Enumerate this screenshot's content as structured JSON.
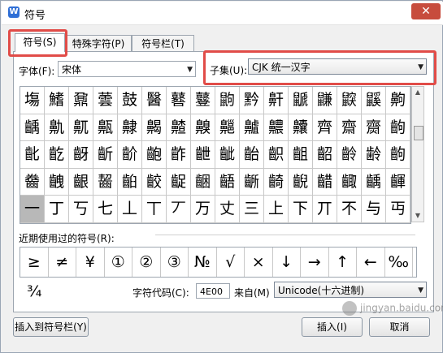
{
  "window": {
    "title": "符号"
  },
  "tabs": [
    "符号(S)",
    "特殊字符(P)",
    "符号栏(T)"
  ],
  "font": {
    "label": "字体(F):",
    "value": "宋体"
  },
  "subset": {
    "label": "子集(U):",
    "value": "CJK 统一汉字"
  },
  "grid": {
    "rows": [
      [
        "塲",
        "鰭",
        "鼐",
        "蕓",
        "鼓",
        "醫",
        "鼛",
        "鼟",
        "鼩",
        "黔",
        "鼾",
        "鼶",
        "鼸",
        "鼵",
        "鼷",
        "齁"
      ],
      [
        "齲",
        "鼽",
        "鼿",
        "齀",
        "齂",
        "齃",
        "齄",
        "齅",
        "齆",
        "齇",
        "齈",
        "齉",
        "齊",
        "齋",
        "齌",
        "齣"
      ],
      [
        "齔",
        "齕",
        "齖",
        "齗",
        "齘",
        "齙",
        "齚",
        "齛",
        "齜",
        "齝",
        "齞",
        "齟",
        "齠",
        "齡",
        "齢",
        "齣"
      ],
      [
        "齤",
        "齥",
        "齦",
        "齧",
        "齨",
        "齩",
        "齪",
        "齫",
        "齬",
        "齭",
        "齮",
        "齯",
        "齰",
        "齱",
        "齲",
        "齳"
      ],
      [
        "一",
        "丁",
        "丂",
        "七",
        "丄",
        "丅",
        "丆",
        "万",
        "丈",
        "三",
        "上",
        "下",
        "丌",
        "不",
        "与",
        "丏"
      ]
    ]
  },
  "recent": {
    "label": "近期使用过的符号(R):",
    "symbols": [
      "≥",
      "≠",
      "¥",
      "①",
      "②",
      "③",
      "№",
      "√",
      "×",
      "↓",
      "→",
      "↑",
      "←",
      "‰",
      "¾"
    ]
  },
  "charcode": {
    "label": "字符代码(C):",
    "value": "4E00",
    "from_label": "来自(M)",
    "from_value": "Unicode(十六进制)"
  },
  "buttons": {
    "insert_to_bar": "插入到符号栏(Y)",
    "insert": "插入(I)",
    "cancel": "取消"
  },
  "watermark": "jingyan.baidu.com"
}
